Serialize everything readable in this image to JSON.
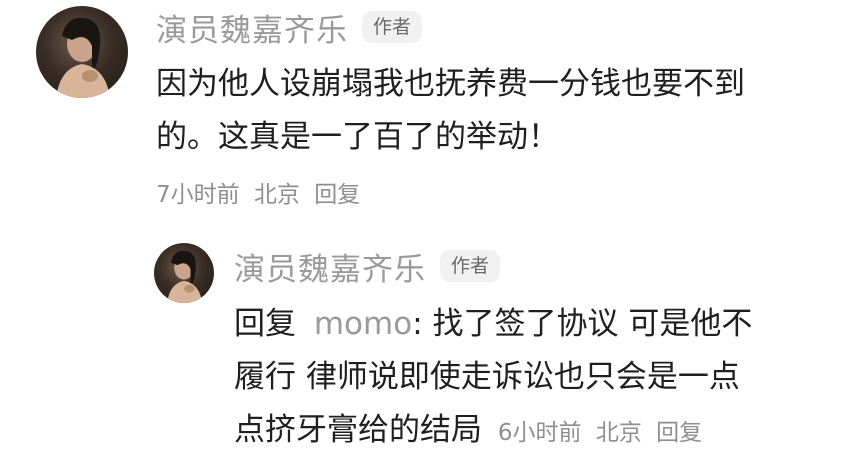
{
  "comments": [
    {
      "author": "演员魏嘉齐乐",
      "badge": "作者",
      "text_line1": "因为他人设崩塌我也抚养费一分钱也要不到",
      "text_line2": "的。这真是一了百了的举动！",
      "time": "7小时前",
      "location": "北京",
      "reply_label": "回复"
    }
  ],
  "replies": [
    {
      "author": "演员魏嘉齐乐",
      "badge": "作者",
      "reply_prefix": "回复",
      "mention": "momo",
      "line1_text": ": 找了签了协议 可是他不",
      "line2": "履行 律师说即使走诉讼也只会是一点",
      "line3": "点挤牙膏给的结局",
      "time": "6小时前",
      "location": "北京",
      "reply_label": "回复"
    }
  ]
}
